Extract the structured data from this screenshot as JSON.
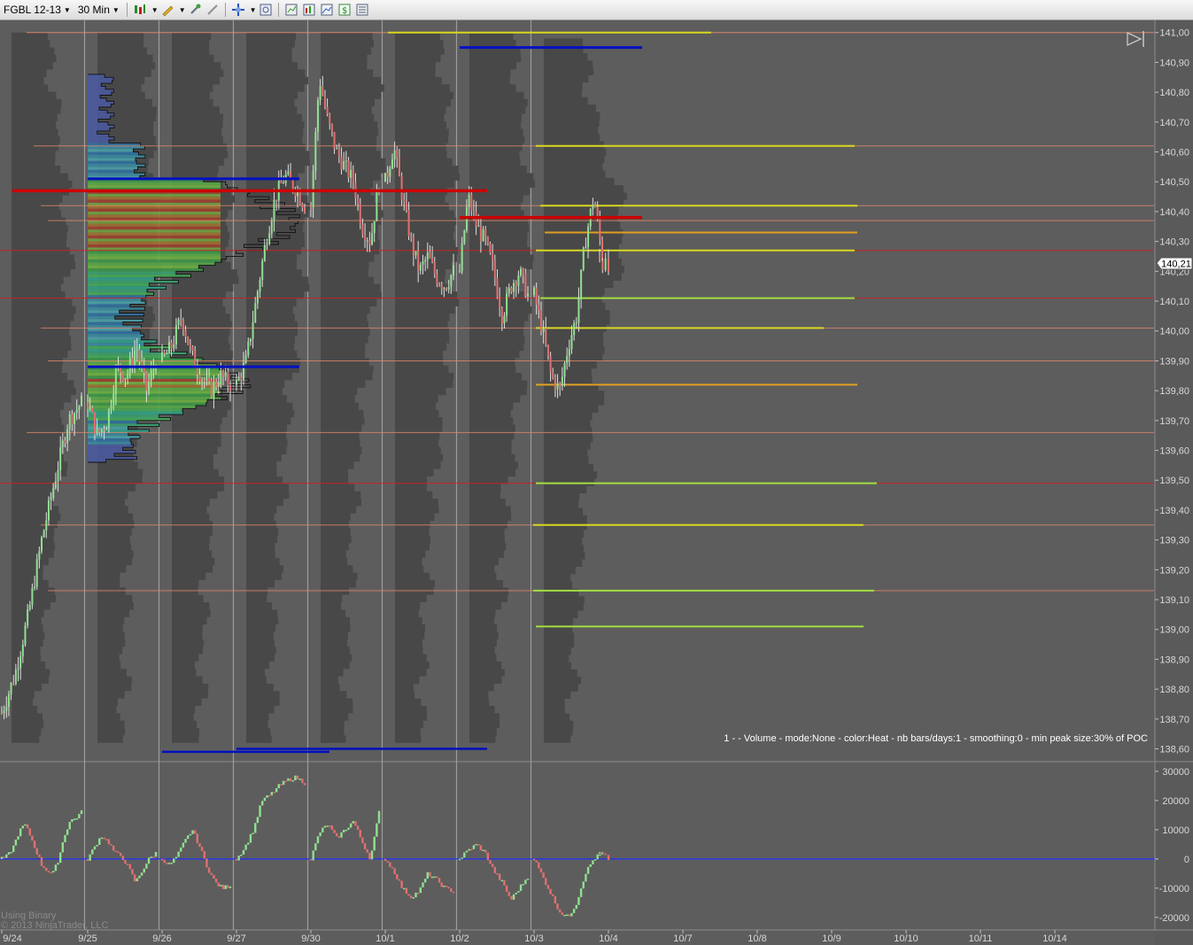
{
  "toolbar": {
    "instrument": "FGBL 12-13",
    "interval": "30 Min",
    "icons": [
      "bar-type-icon",
      "drawing-pencil-icon",
      "magnet-icon",
      "crosshair-icon",
      "zoom-icon",
      "data-box-icon",
      "strategy-icon",
      "indicator-icon",
      "dollar-icon",
      "properties-icon"
    ]
  },
  "colors": {
    "background": "#5d5d5d",
    "profile_shade": "#484848",
    "poc_red": "#cc0000",
    "value_blue": "#0010c0",
    "level_yellow": "#d8d820",
    "level_green": "#a0e040",
    "level_orange": "#e0a020",
    "salmon_line": "#e88a6a",
    "candle_up": "#90e090",
    "candle_down": "#e07070",
    "zero_line": "#2030ff"
  },
  "info_text": "1 -   - Volume - mode:None - color:Heat - nb bars/days:1 - smoothing:0 - min peak size:30% of POC",
  "watermark": [
    "Using Binary",
    "© 2013 NinjaTrader, LLC"
  ],
  "last_price_label": "140,21",
  "chart_data": [
    {
      "type": "candlestick",
      "panel": "price",
      "instrument": "FGBL 12-13",
      "y_ticks": [
        "141,00",
        "140,90",
        "140,80",
        "140,70",
        "140,60",
        "140,50",
        "140,40",
        "140,30",
        "140,20",
        "140,10",
        "140,00",
        "139,90",
        "139,80",
        "139,70",
        "139,60",
        "139,50",
        "139,40",
        "139,30",
        "139,20",
        "139,10",
        "139,00",
        "138,90",
        "138,80",
        "138,70",
        "138,60"
      ],
      "ylim": [
        138.56,
        141.02
      ],
      "x_tick_labels": [
        "9/24",
        "9/25",
        "9/26",
        "9/27",
        "9/30",
        "10/1",
        "10/2",
        "10/3",
        "10/4",
        "10/7",
        "10/8",
        "10/9",
        "10/10",
        "10/11",
        "10/14"
      ],
      "last_price": 140.21,
      "session_closes": [
        {
          "session": "9/24",
          "path": [
            138.72,
            138.85,
            139.05,
            139.3,
            139.5,
            139.7,
            139.76
          ]
        },
        {
          "session": "9/25",
          "path": [
            139.76,
            139.65,
            139.7,
            139.88,
            139.85,
            139.95,
            139.8,
            139.9
          ]
        },
        {
          "session": "9/26",
          "path": [
            139.9,
            139.95,
            140.05,
            139.92,
            139.85,
            139.8,
            139.85,
            139.82
          ]
        },
        {
          "session": "9/27",
          "path": [
            139.82,
            139.9,
            140.1,
            140.3,
            140.45,
            140.52,
            140.48,
            140.42
          ]
        },
        {
          "session": "9/30",
          "path": [
            140.42,
            140.85,
            140.7,
            140.6,
            140.55,
            140.5,
            140.35,
            140.3,
            140.5
          ]
        },
        {
          "session": "10/1",
          "path": [
            140.5,
            140.62,
            140.45,
            140.3,
            140.2,
            140.25,
            140.18,
            140.15,
            140.2
          ]
        },
        {
          "session": "10/2",
          "path": [
            140.2,
            140.45,
            140.35,
            140.3,
            140.2,
            140.05,
            140.15,
            140.2,
            140.12
          ]
        },
        {
          "session": "10/3",
          "path": [
            140.12,
            140.0,
            139.85,
            139.8,
            139.95,
            140.05,
            140.3,
            140.45,
            140.25
          ]
        },
        {
          "session": "10/4",
          "path": [
            140.25,
            140.2
          ]
        }
      ],
      "poc_levels": [
        140.47,
        140.38
      ],
      "value_area_lines": [
        140.51,
        139.88,
        140.95,
        138.59,
        138.6
      ],
      "developing_levels": [
        {
          "price": 141.0,
          "color": "yellow"
        },
        {
          "price": 140.62,
          "color": "yellow"
        },
        {
          "price": 140.42,
          "color": "yellow"
        },
        {
          "price": 140.33,
          "color": "orange"
        },
        {
          "price": 140.27,
          "color": "yellow"
        },
        {
          "price": 140.11,
          "color": "green"
        },
        {
          "price": 140.01,
          "color": "yellow"
        },
        {
          "price": 139.82,
          "color": "orange"
        },
        {
          "price": 139.49,
          "color": "green"
        },
        {
          "price": 139.35,
          "color": "yellow"
        },
        {
          "price": 139.13,
          "color": "green"
        },
        {
          "price": 139.01,
          "color": "green"
        }
      ],
      "salmon_levels": [
        141.0,
        140.62,
        140.42,
        140.37,
        140.27,
        140.11,
        140.01,
        139.9,
        139.66,
        139.49,
        139.35,
        139.13
      ]
    },
    {
      "type": "bar",
      "panel": "indicator",
      "y_ticks": [
        "30000",
        "20000",
        "10000",
        "0",
        "-10000",
        "-20000"
      ],
      "ylim": [
        -24000,
        33000
      ],
      "sessions": [
        {
          "session": "9/24",
          "values": [
            0,
            1000,
            4000,
            9000,
            12000,
            8000,
            3000,
            -2000,
            -4000,
            -5000,
            0,
            8000,
            13000,
            14000,
            16000
          ]
        },
        {
          "session": "9/25",
          "values": [
            0,
            4000,
            8000,
            6000,
            2000,
            1000,
            -3000,
            -8000,
            -4000,
            0,
            2000
          ]
        },
        {
          "session": "9/26",
          "values": [
            0,
            -2000,
            1000,
            6000,
            10000,
            4000,
            -3000,
            -8000,
            -10000,
            -9000
          ]
        },
        {
          "session": "9/27",
          "values": [
            0,
            4000,
            10000,
            20000,
            22000,
            25000,
            27000,
            28000,
            26000
          ]
        },
        {
          "session": "9/30",
          "values": [
            0,
            9000,
            12000,
            7000,
            10000,
            13000,
            6000,
            0,
            16000
          ]
        },
        {
          "session": "10/1",
          "values": [
            0,
            -4000,
            -10000,
            -13000,
            -11000,
            -5000,
            -7000,
            -10000,
            -11000
          ]
        },
        {
          "session": "10/2",
          "values": [
            0,
            3000,
            5000,
            2000,
            -4000,
            -8000,
            -14000,
            -10000,
            -6000
          ]
        },
        {
          "session": "10/3",
          "values": [
            0,
            -6000,
            -12000,
            -18000,
            -20000,
            -15000,
            -5000,
            0,
            2000
          ]
        },
        {
          "session": "10/4",
          "values": [
            2000,
            0
          ]
        }
      ]
    }
  ]
}
